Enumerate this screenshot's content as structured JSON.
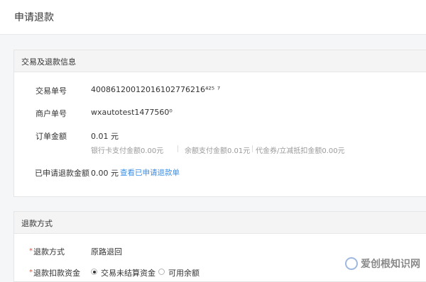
{
  "page": {
    "title": "申请退款"
  },
  "trade_panel": {
    "title": "交易及退款信息",
    "trade_no_label": "交易单号",
    "trade_no_value": "40086120012016102776216⁴²⁵ ⁷",
    "merchant_no_label": "商户单号",
    "merchant_no_value": "wxautotest1477560⁰",
    "order_amount_label": "订单金额",
    "order_amount_value": "0.01 元",
    "breakdown": [
      "银行卡支付金额0.00元",
      "余额支付金额0.01元",
      "代金券/立减抵扣金额0.00元"
    ],
    "refunded_label": "已申请退款金额",
    "refunded_value": "0.00 元",
    "refunded_link": "查看已申请退款单"
  },
  "refund_panel": {
    "title": "退款方式",
    "method_label": "退款方式",
    "method_value": "原路退回",
    "fund_label": "退款扣款资金",
    "fund_options": [
      "交易未结算资金",
      "可用余额"
    ],
    "fund_selected": "交易未结算资金"
  },
  "watermark": {
    "text": "爱创根知识网"
  },
  "colors": {
    "link": "#3a8ee6",
    "required": "#e8503a",
    "panel_header_bg": "#f4f4f4",
    "page_bg": "#f5f6f7"
  }
}
